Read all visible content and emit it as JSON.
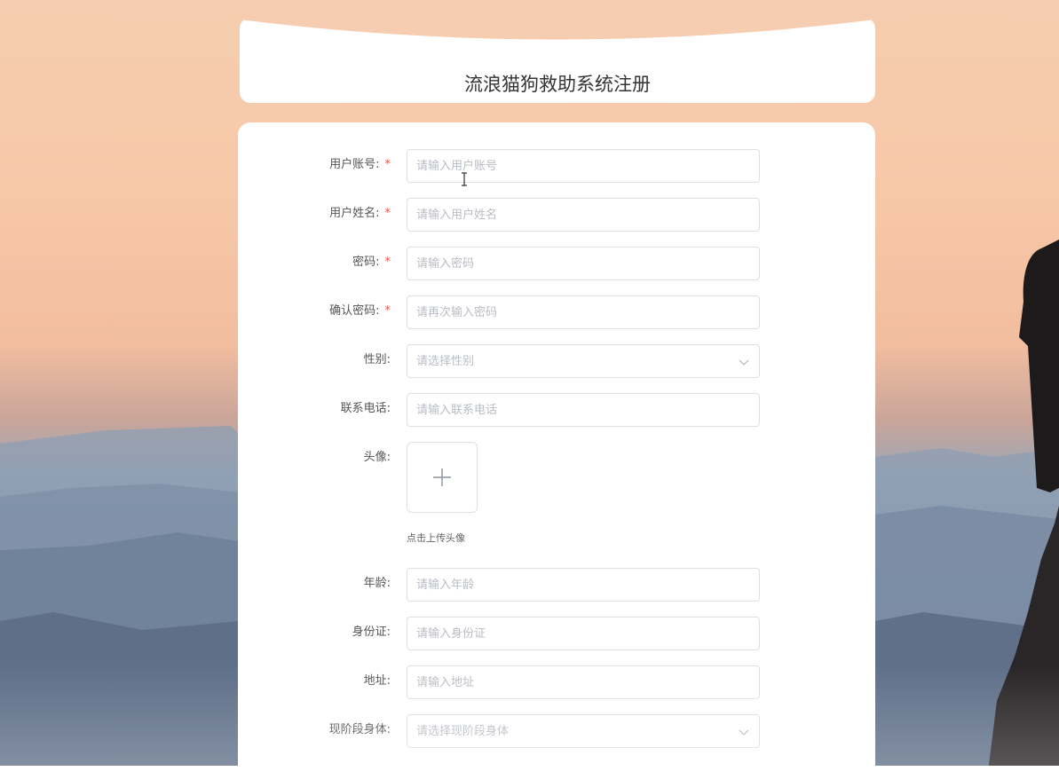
{
  "page": {
    "title": "流浪猫狗救助系统注册"
  },
  "form": {
    "fields": [
      {
        "label": "用户账号:",
        "required": true,
        "placeholder": "请输入用户账号",
        "type": "input"
      },
      {
        "label": "用户姓名:",
        "required": true,
        "placeholder": "请输入用户姓名",
        "type": "input"
      },
      {
        "label": "密码:",
        "required": true,
        "placeholder": "请输入密码",
        "type": "input"
      },
      {
        "label": "确认密码:",
        "required": true,
        "placeholder": "请再次输入密码",
        "type": "input"
      },
      {
        "label": "性别:",
        "required": false,
        "placeholder": "请选择性别",
        "type": "select"
      },
      {
        "label": "联系电话:",
        "required": false,
        "placeholder": "请输入联系电话",
        "type": "input"
      },
      {
        "label": "头像:",
        "required": false,
        "type": "upload"
      },
      {
        "label": "年龄:",
        "required": false,
        "placeholder": "请输入年龄",
        "type": "input"
      },
      {
        "label": "身份证:",
        "required": false,
        "placeholder": "请输入身份证",
        "type": "input"
      },
      {
        "label": "地址:",
        "required": false,
        "placeholder": "请输入地址",
        "type": "input"
      },
      {
        "label": "现阶段身体:",
        "required": false,
        "placeholder": "请选择现阶段身体",
        "type": "select"
      }
    ],
    "required_mark": "*",
    "upload_hint": "点击上传头像",
    "upload_icon": "plus-icon",
    "select_icon": "chevron-down-icon"
  },
  "colors": {
    "required": "#f0504a",
    "border": "#dcdfe6",
    "placeholder": "#b8bcc4"
  }
}
